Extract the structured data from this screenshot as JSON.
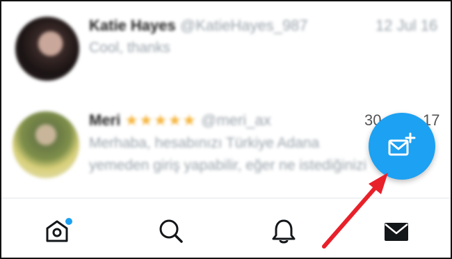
{
  "conversations": [
    {
      "name": "Katie Hayes",
      "handle": "@KatieHayes_987",
      "date": "12 Jul 16",
      "snippet": "Cool, thanks"
    },
    {
      "name": "Meri",
      "stars": "★★★★★",
      "handle": "@meri_ax",
      "date_prefix": "30",
      "date_suffix": "17",
      "snippet_line1": "Merhaba, hesabınızı Türkiye Adana",
      "snippet_line2": "yemeden giriş yapabilir, eğer ne istediğinizi"
    }
  ],
  "fab": {
    "icon": "new-message-icon"
  },
  "tabbar": {
    "items": [
      {
        "id": "home",
        "icon": "home-icon",
        "badge": true,
        "active": false
      },
      {
        "id": "search",
        "icon": "search-icon",
        "badge": false,
        "active": false
      },
      {
        "id": "notifications",
        "icon": "bell-icon",
        "badge": false,
        "active": false
      },
      {
        "id": "messages",
        "icon": "mail-icon",
        "badge": false,
        "active": true
      }
    ]
  },
  "colors": {
    "accent": "#1da1f2",
    "arrow": "#e8202a",
    "star": "#f5b43c",
    "icon": "#14171a"
  }
}
